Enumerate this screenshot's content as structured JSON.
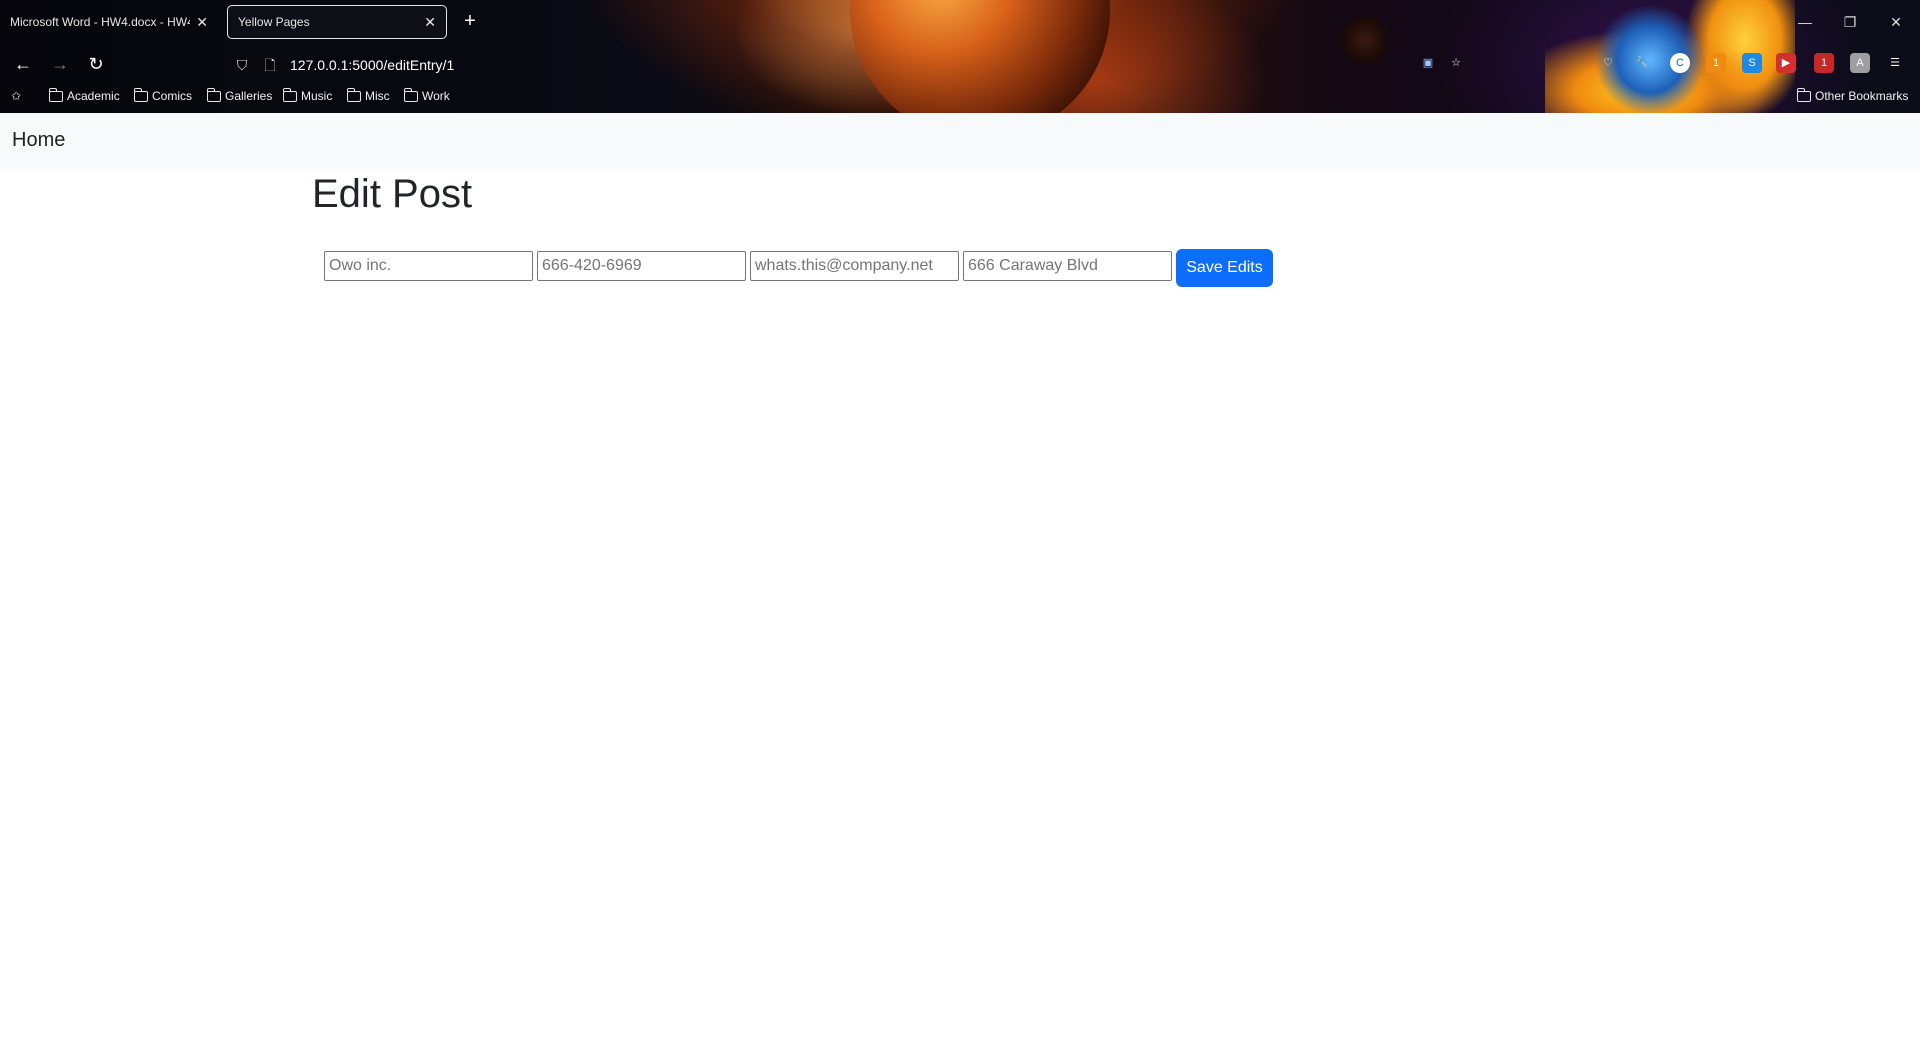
{
  "browser": {
    "tabs": [
      {
        "title": "Microsoft Word - HW4.docx - HW4",
        "active": false
      },
      {
        "title": "Yellow Pages",
        "active": true
      }
    ],
    "url": "127.0.0.1:5000/editEntry/1",
    "bookmarks": [
      "Academic",
      "Comics",
      "Galleries",
      "Music",
      "Misc",
      "Work"
    ],
    "other_bookmarks": "Other Bookmarks",
    "extension_badges": {
      "ext_a": "1",
      "ext_b": "1"
    }
  },
  "navbar": {
    "brand": "Home"
  },
  "page": {
    "title": "Edit Post",
    "fields": {
      "name_placeholder": "Owo inc.",
      "phone_placeholder": "666-420-6969",
      "email_placeholder": "whats.this@company.net",
      "address_placeholder": "666 Caraway Blvd"
    },
    "save_label": "Save Edits"
  },
  "colors": {
    "primary": "#0d6efd",
    "navbar_bg": "#f8f9fa"
  }
}
